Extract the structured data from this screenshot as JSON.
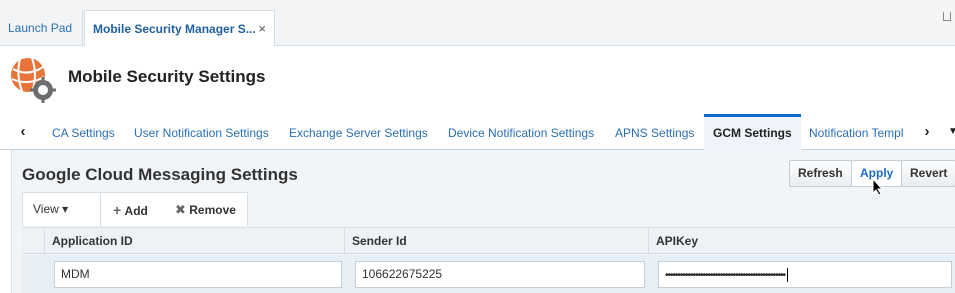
{
  "tabs": [
    {
      "label": "Launch Pad"
    },
    {
      "label": "Mobile Security Manager S...",
      "close": "×"
    }
  ],
  "header": {
    "title": "Mobile Security Settings"
  },
  "subtabs": [
    "CA Settings",
    "User Notification Settings",
    "Exchange Server Settings",
    "Device Notification Settings",
    "APNS Settings",
    "GCM Settings",
    "Notification Templ"
  ],
  "active_subtab": "GCM Settings",
  "panel": {
    "title": "Google Cloud Messaging Settings",
    "buttons": {
      "refresh": "Refresh",
      "apply": "Apply",
      "revert": "Revert"
    }
  },
  "toolbar": {
    "view": "View",
    "add": "Add",
    "remove": "Remove"
  },
  "table": {
    "columns": [
      "Application ID",
      "Sender Id",
      "APIKey"
    ],
    "rows": [
      {
        "application_id": "MDM",
        "sender_id": "106622675225",
        "api_key": "••••••••••••••••••••••••••••••••••••••••••••••••"
      }
    ]
  },
  "colors": {
    "accent": "#0b6cc7",
    "link": "#2a6fb3",
    "logo_orange": "#e8743b"
  },
  "icons": [
    "globe-gear-icon",
    "close-icon",
    "chevron-left-icon",
    "chevron-right-icon",
    "caret-down-icon",
    "plus-icon",
    "x-icon",
    "pointer-cursor-icon"
  ]
}
